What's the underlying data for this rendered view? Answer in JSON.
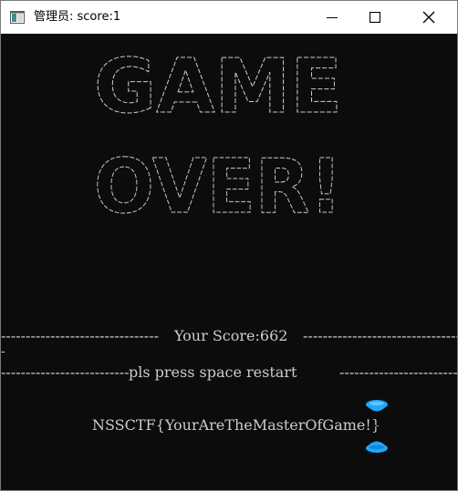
{
  "window": {
    "title": "管理员:  score:1",
    "app_icon": "console-app-icon",
    "controls": {
      "minimize_icon": "minimize-icon",
      "maximize_icon": "maximize-icon",
      "close_icon": "close-icon"
    }
  },
  "console": {
    "background": "#0c0c0c",
    "text_color": "#cccccc",
    "ascii_art": {
      "line1": "GAME",
      "line2": "OVER!"
    },
    "score_line": {
      "label": "Your Score:662",
      "tail": "-"
    },
    "restart_line": {
      "label": "pls press space restart"
    },
    "flag": "NSSCTF{YourAreTheMasterOfGame!}",
    "cursor_icon": "hourglass-busy-icon",
    "cursor_color": "#1ea7ff"
  }
}
